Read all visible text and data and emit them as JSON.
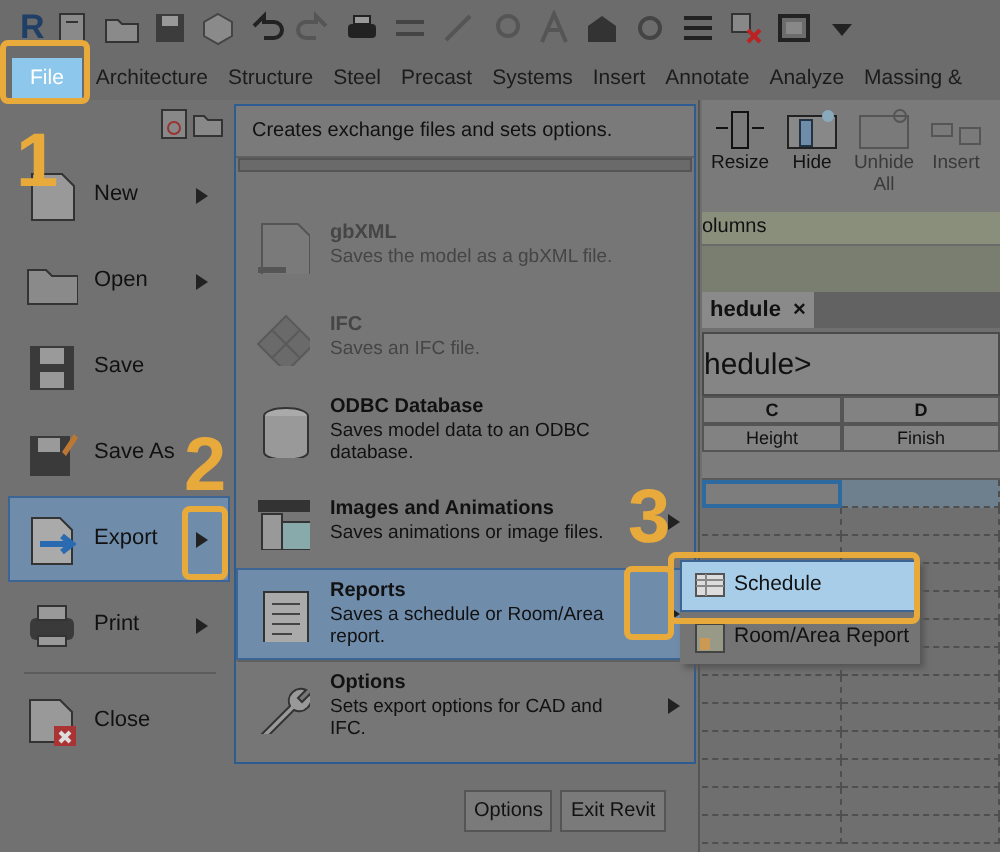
{
  "quick_access_toolbar": {
    "logo": "R"
  },
  "ribbon_tabs": [
    {
      "label": "File",
      "selected": true
    },
    {
      "label": "Architecture",
      "selected": false
    },
    {
      "label": "Structure",
      "selected": false
    },
    {
      "label": "Steel",
      "selected": false
    },
    {
      "label": "Precast",
      "selected": false
    },
    {
      "label": "Systems",
      "selected": false
    },
    {
      "label": "Insert",
      "selected": false
    },
    {
      "label": "Annotate",
      "selected": false
    },
    {
      "label": "Analyze",
      "selected": false
    },
    {
      "label": "Massing &",
      "selected": false
    }
  ],
  "ribbon_buttons": [
    {
      "label": "Resize",
      "disabled": false
    },
    {
      "label": "Hide",
      "disabled": false
    },
    {
      "label": "Unhide All",
      "disabled": true
    },
    {
      "label": "Insert",
      "disabled": true
    }
  ],
  "ribbon_panel_label": "olumns",
  "view_tab": {
    "label": "hedule",
    "close": "×"
  },
  "schedule": {
    "title": "hedule>",
    "columns": [
      {
        "letter": "C",
        "heading": "Height"
      },
      {
        "letter": "D",
        "heading": "Finish"
      }
    ]
  },
  "application_menu": {
    "items": [
      {
        "label": "New",
        "has_submenu": true,
        "selected": false
      },
      {
        "label": "Open",
        "has_submenu": true,
        "selected": false
      },
      {
        "label": "Save",
        "has_submenu": false,
        "selected": false
      },
      {
        "label": "Save As",
        "has_submenu": false,
        "selected": false
      },
      {
        "label": "Export",
        "has_submenu": true,
        "selected": true
      },
      {
        "label": "Print",
        "has_submenu": true,
        "selected": false
      },
      {
        "label": "Close",
        "has_submenu": false,
        "selected": false
      }
    ],
    "buttons": [
      "Options",
      "Exit Revit"
    ]
  },
  "export_menu": {
    "header": "Creates exchange files and sets options.",
    "items": [
      {
        "title": "gbXML",
        "description": "Saves the model as a gbXML file.",
        "disabled": true,
        "has_submenu": false,
        "selected": false
      },
      {
        "title": "IFC",
        "description": "Saves an IFC file.",
        "disabled": true,
        "has_submenu": false,
        "selected": false
      },
      {
        "title": "ODBC Database",
        "description": "Saves model data to an ODBC database.",
        "disabled": false,
        "has_submenu": false,
        "selected": false
      },
      {
        "title": "Images and Animations",
        "description": "Saves animations or image files.",
        "disabled": false,
        "has_submenu": true,
        "selected": false
      },
      {
        "title": "Reports",
        "description": "Saves a schedule or Room/Area report.",
        "disabled": false,
        "has_submenu": true,
        "selected": true
      },
      {
        "title": "Options",
        "description": "Sets export options for CAD and IFC.",
        "disabled": false,
        "has_submenu": true,
        "selected": false
      }
    ]
  },
  "reports_menu": [
    {
      "label": "Schedule",
      "selected": true
    },
    {
      "label": "Room/Area Report",
      "selected": false
    }
  ],
  "callouts": [
    "1",
    "2",
    "3"
  ]
}
